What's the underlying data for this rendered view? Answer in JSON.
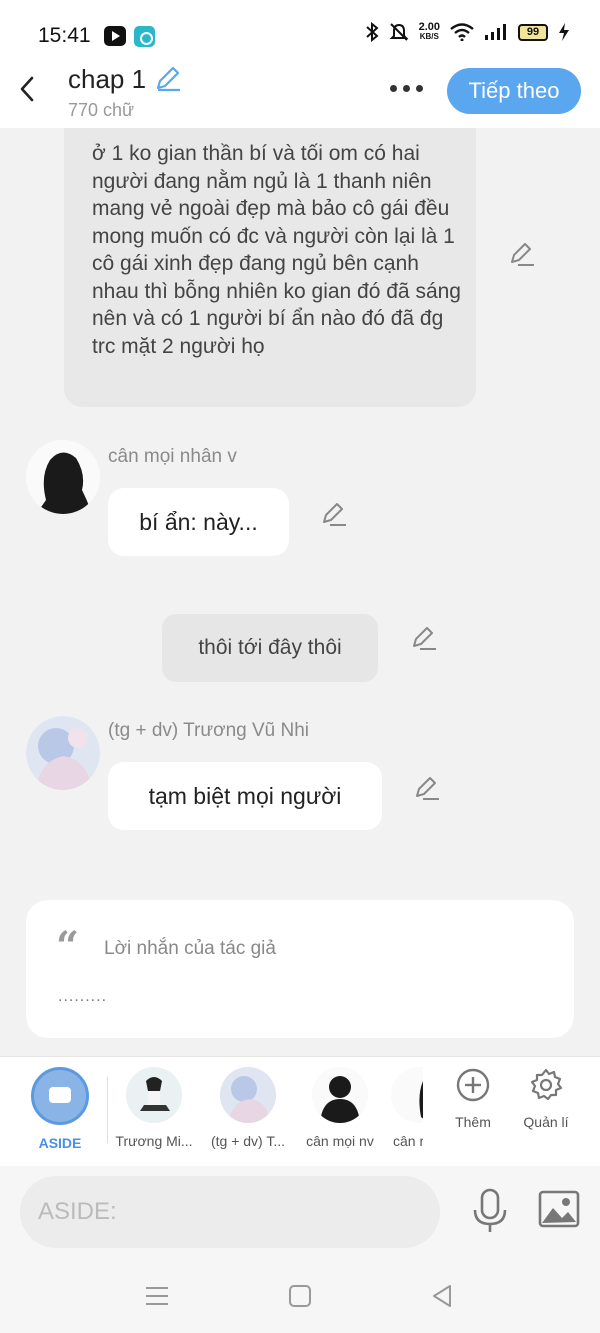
{
  "status_bar": {
    "time": "15:41",
    "net_speed_value": "2.00",
    "net_speed_unit": "KB/S",
    "battery": "99",
    "icons": [
      "youtube-icon",
      "app-icon",
      "bluetooth-icon",
      "mute-icon",
      "wifi-icon",
      "signal-icon",
      "battery-icon",
      "charging-icon"
    ]
  },
  "header": {
    "title": "chap 1",
    "word_count": "770 chữ",
    "next_button": "Tiếp theo"
  },
  "messages": {
    "narration": "ở 1 ko gian thần bí và tối om có hai người đang nằm ngủ là 1 thanh niên mang vẻ ngoài đẹp mà bảo cô gái đều mong muốn có đc và người còn lại là 1 cô gái xinh đẹp đang ngủ bên cạnh nhau thì bỗng nhiên ko gian đó đã sáng nên và có 1 người bí ẩn nào đó đã đg trc mặt 2 người họ",
    "msg1_speaker": "cân mọi nhân v",
    "msg1_text": "bí ẩn: này...",
    "aside_text": "thôi tới đây thôi",
    "msg2_speaker": "(tg + dv) Trương Vũ Nhi",
    "msg2_text": "tạm biệt mọi người"
  },
  "author_note": {
    "title": "Lời nhắn của tác giả",
    "body": "........."
  },
  "character_bar": {
    "characters": [
      {
        "label": "ASIDE"
      },
      {
        "label": "Trương Mi..."
      },
      {
        "label": "(tg + dv) T..."
      },
      {
        "label": "cân mọi nv"
      },
      {
        "label": "cân m"
      }
    ],
    "add_label": "Thêm",
    "manage_label": "Quản lí"
  },
  "input": {
    "placeholder": "ASIDE:"
  },
  "colors": {
    "accent": "#5aa7ef",
    "aside_active": "#4a90e2"
  }
}
